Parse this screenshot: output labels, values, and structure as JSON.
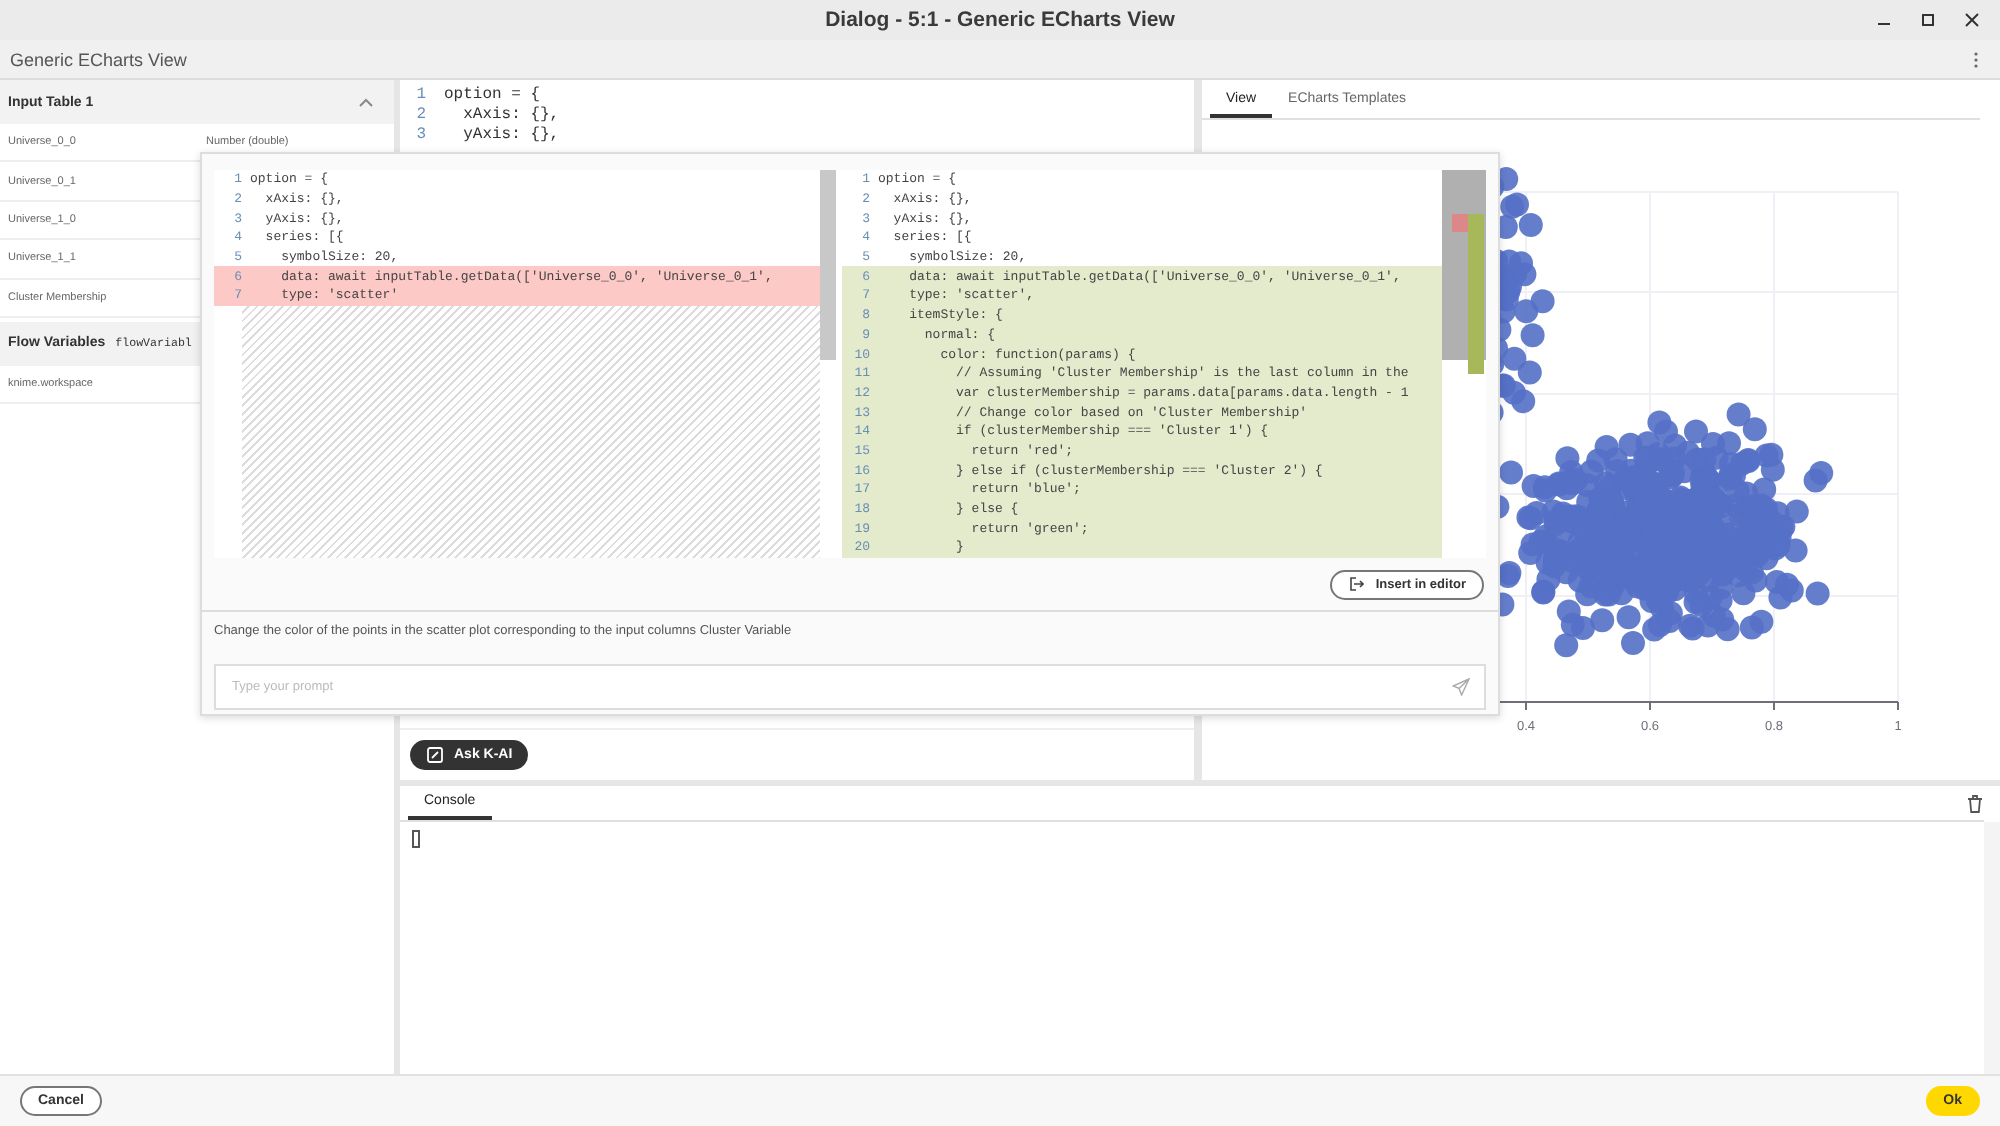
{
  "window": {
    "title": "Dialog - 5:1 - Generic ECharts View"
  },
  "header": {
    "title": "Generic ECharts View"
  },
  "input_table": {
    "title": "Input Table 1",
    "expanded": true,
    "columns": [
      {
        "name": "Universe_0_0",
        "type": "Number (double)"
      },
      {
        "name": "Universe_0_1"
      },
      {
        "name": "Universe_1_0"
      },
      {
        "name": "Universe_1_1"
      },
      {
        "name": "Cluster Membership"
      }
    ]
  },
  "flow_variables": {
    "title": "Flow Variables",
    "column_2": "flowVariabl",
    "items": [
      "knime.workspace"
    ]
  },
  "editor": {
    "lines": [
      {
        "number": "1",
        "text": "option = {"
      },
      {
        "number": "2",
        "text": "  xAxis: {},"
      },
      {
        "number": "3",
        "text": "  yAxis: {},"
      }
    ]
  },
  "ai_popup": {
    "original": {
      "lines": [
        {
          "number": "1",
          "text": "option = {",
          "kind": "unchanged"
        },
        {
          "number": "2",
          "text": "  xAxis: {},",
          "kind": "unchanged"
        },
        {
          "number": "3",
          "text": "  yAxis: {},",
          "kind": "unchanged"
        },
        {
          "number": "4",
          "text": "  series: [{",
          "kind": "unchanged"
        },
        {
          "number": "5",
          "text": "    symbolSize: 20,",
          "kind": "unchanged"
        },
        {
          "number": "6",
          "text": "    data: await inputTable.getData(['Universe_0_0', 'Universe_0_1',",
          "kind": "removed"
        },
        {
          "number": "7",
          "text": "    type: 'scatter'",
          "kind": "removed"
        }
      ]
    },
    "suggestion": {
      "lines": [
        {
          "number": "1",
          "text": "option = {",
          "kind": "unchanged"
        },
        {
          "number": "2",
          "text": "  xAxis: {},",
          "kind": "unchanged"
        },
        {
          "number": "3",
          "text": "  yAxis: {},",
          "kind": "unchanged"
        },
        {
          "number": "4",
          "text": "  series: [{",
          "kind": "unchanged"
        },
        {
          "number": "5",
          "text": "    symbolSize: 20,",
          "kind": "unchanged"
        },
        {
          "number": "6",
          "text": "    data: await inputTable.getData(['Universe_0_0', 'Universe_0_1',",
          "kind": "added"
        },
        {
          "number": "7",
          "text": "    type: 'scatter',",
          "kind": "added"
        },
        {
          "number": "8",
          "text": "    itemStyle: {",
          "kind": "added"
        },
        {
          "number": "9",
          "text": "      normal: {",
          "kind": "added"
        },
        {
          "number": "10",
          "text": "        color: function(params) {",
          "kind": "added"
        },
        {
          "number": "11",
          "text": "          // Assuming 'Cluster Membership' is the last column in the",
          "kind": "added"
        },
        {
          "number": "12",
          "text": "          var clusterMembership = params.data[params.data.length - 1",
          "kind": "added"
        },
        {
          "number": "13",
          "text": "          // Change color based on 'Cluster Membership'",
          "kind": "added"
        },
        {
          "number": "14",
          "text": "          if (clusterMembership === 'Cluster 1') {",
          "kind": "added"
        },
        {
          "number": "15",
          "text": "            return 'red';",
          "kind": "added"
        },
        {
          "number": "16",
          "text": "          } else if (clusterMembership === 'Cluster 2') {",
          "kind": "added"
        },
        {
          "number": "17",
          "text": "            return 'blue';",
          "kind": "added"
        },
        {
          "number": "18",
          "text": "          } else {",
          "kind": "added"
        },
        {
          "number": "19",
          "text": "            return 'green';",
          "kind": "added"
        },
        {
          "number": "20",
          "text": "          }",
          "kind": "added"
        }
      ]
    },
    "insert_button": "Insert in editor",
    "prompt": "Change the color of the points in the scatter plot corresponding to the input columns Cluster Variable",
    "input": {
      "placeholder": "Type your prompt"
    }
  },
  "ask_button": "Ask K-AI",
  "view_tabs": [
    {
      "label": "View",
      "selected": true
    },
    {
      "label": "ECharts Templates",
      "selected": false
    }
  ],
  "chart": {
    "x_tick_labels": [
      "0.4",
      "0.6",
      "0.8",
      "1"
    ]
  },
  "console": {
    "tabs": [
      {
        "label": "Console",
        "selected": true
      }
    ]
  },
  "footer": {
    "cancel": "Cancel",
    "ok": "Ok"
  }
}
